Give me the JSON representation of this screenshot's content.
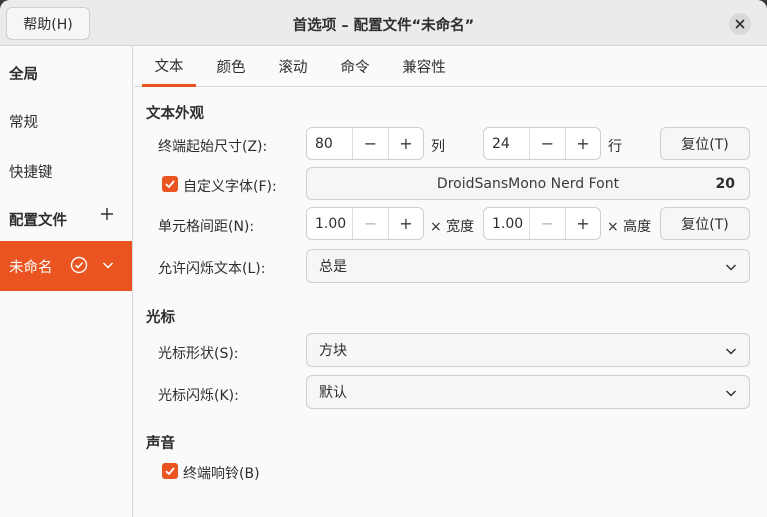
{
  "titlebar": {
    "help_label": "帮助(H)",
    "title": "首选项 – 配置文件“未命名”"
  },
  "sidebar": {
    "global_header": "全局",
    "general": "常规",
    "shortcuts": "快捷键",
    "profiles_header": "配置文件",
    "profile_selected": "未命名"
  },
  "tabs": [
    "文本",
    "颜色",
    "滚动",
    "命令",
    "兼容性"
  ],
  "text": {
    "appearance_title": "文本外观",
    "initial_size_label": "终端起始尺寸(Z):",
    "columns_value": "80",
    "columns_unit": "列",
    "rows_value": "24",
    "rows_unit": "行",
    "reset_label": "复位(T)",
    "custom_font_label": "自定义字体(F):",
    "custom_font_checked": true,
    "font_name": "DroidSansMono Nerd Font",
    "font_size": "20",
    "cell_spacing_label": "单元格间距(N):",
    "width_value": "1.00",
    "width_unit": "× 宽度",
    "height_value": "1.00",
    "height_unit": "× 高度",
    "reset2_label": "复位(T)",
    "blink_text_label": "允许闪烁文本(L):",
    "blink_text_value": "总是",
    "cursor_title": "光标",
    "cursor_shape_label": "光标形状(S):",
    "cursor_shape_value": "方块",
    "cursor_blink_label": "光标闪烁(K):",
    "cursor_blink_value": "默认",
    "sound_title": "声音",
    "bell_label": "终端响铃(B)",
    "bell_checked": true
  },
  "colors": {
    "accent": "#e95420",
    "window_bg": "#fafafa",
    "titlebar_bg": "#ebebeb"
  }
}
